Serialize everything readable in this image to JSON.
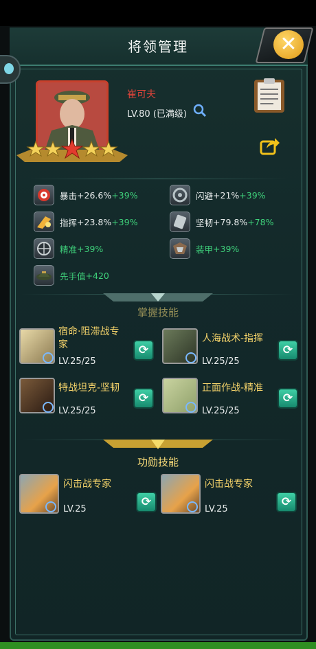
{
  "window": {
    "title": "将领管理"
  },
  "general": {
    "name": "崔可夫",
    "level": "LV.80 (已满级)",
    "stars": 5
  },
  "stats": [
    {
      "label": "暴击",
      "value": "+26.6%",
      "bonus": "+39%",
      "icon": "crit-target-icon"
    },
    {
      "label": "闪避",
      "value": "+21%",
      "bonus": "+39%",
      "icon": "dodge-icon"
    },
    {
      "label": "指挥",
      "value": "+23.8%",
      "bonus": "+39%",
      "icon": "command-icon"
    },
    {
      "label": "坚韧",
      "value": "+79.8%",
      "bonus": "+78%",
      "icon": "toughness-icon"
    },
    {
      "label": "精准",
      "value": "",
      "bonus": "+39%",
      "icon": "crosshair-icon"
    },
    {
      "label": "装甲",
      "value": "",
      "bonus": "+39%",
      "icon": "armor-icon"
    },
    {
      "label": "先手值",
      "value": "",
      "bonus": "+420",
      "icon": "helmet-icon"
    }
  ],
  "sections": {
    "command": "掌握技能",
    "merit": "功勋技能"
  },
  "command_skills": [
    {
      "name": "宿命·阻滞战专家",
      "level": "LV.25/25"
    },
    {
      "name": "人海战术-指挥",
      "level": "LV.25/25"
    },
    {
      "name": "特战坦克-坚韧",
      "level": "LV.25/25"
    },
    {
      "name": "正面作战-精准",
      "level": "LV.25/25"
    }
  ],
  "merit_skills": [
    {
      "name": "闪击战专家",
      "level": "LV.25"
    },
    {
      "name": "闪击战专家",
      "level": "LV.25"
    }
  ],
  "colors": {
    "accent_green": "#3fd27b",
    "name_red": "#e0443a",
    "gold": "#f3d26a"
  }
}
